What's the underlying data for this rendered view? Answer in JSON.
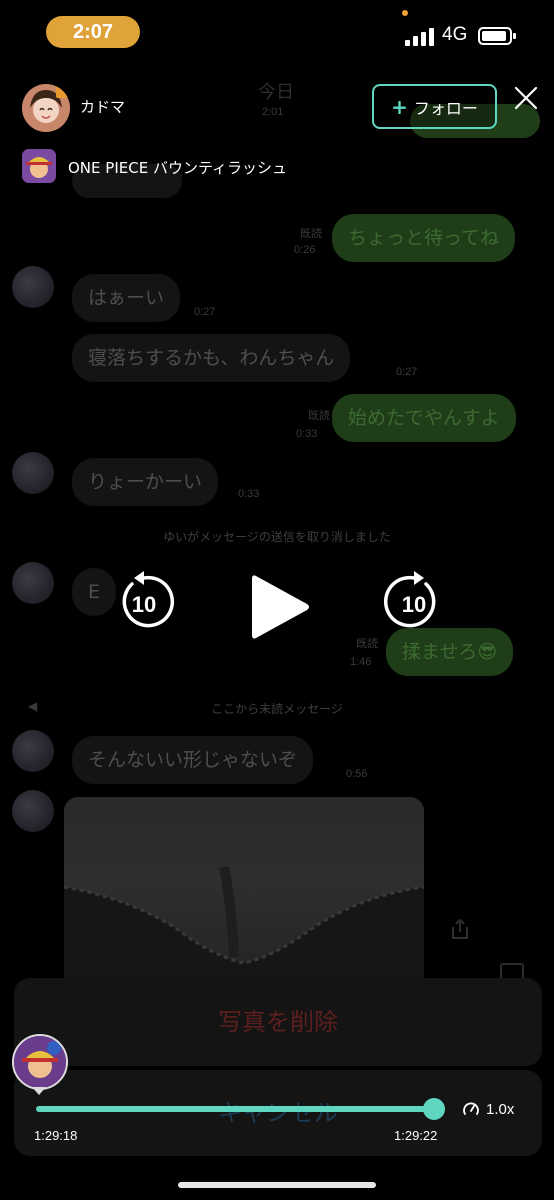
{
  "status_bar": {
    "time": "2:07",
    "network": "4G",
    "accent_color": "#e0a33a"
  },
  "chat": {
    "date_header": "今日",
    "date_time": "2:01",
    "messages": [
      {
        "side": "out",
        "text": "ちょっと待ってね",
        "read": "既読",
        "time": "0:26"
      },
      {
        "side": "in",
        "text": "はぁーい",
        "time": "0:27"
      },
      {
        "side": "in",
        "text": "寝落ちするかも、わんちゃん",
        "time": "0:27"
      },
      {
        "side": "out",
        "text": "始めたでやんすよ",
        "read": "既読",
        "time": "0:33"
      },
      {
        "side": "in",
        "text": "りょーかーい",
        "time": "0:33"
      },
      {
        "side": "in",
        "text": "E"
      },
      {
        "side": "out",
        "text": "揉ませろ😎",
        "read": "既読",
        "time": "1:46"
      },
      {
        "side": "in",
        "text": "そんないい形じゃないぞ",
        "time": "0:56"
      }
    ],
    "unsent_notice": "ゆいがメッセージの送信を取り消しました",
    "unread_divider": "ここから未読メッセージ",
    "sheet_delete": "写真を削除",
    "sheet_cancel": "キャンセル"
  },
  "header": {
    "creator_name": "カドマ",
    "follow_label": "フォロー",
    "game_name": "ONE PIECE バウンティラッシュ",
    "follow_color": "#5fd6c0"
  },
  "controls": {
    "rewind_seconds": "10",
    "forward_seconds": "10"
  },
  "player": {
    "current_time": "1:29:18",
    "end_time": "1:29:22",
    "speed": "1.0x",
    "progress_fraction": 1.0
  }
}
